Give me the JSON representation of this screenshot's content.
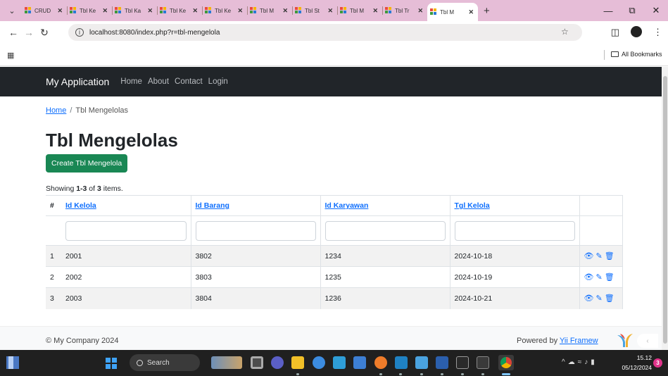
{
  "browser": {
    "tabs": [
      {
        "label": "CRUD",
        "active": false
      },
      {
        "label": "Tbl Ke",
        "active": false
      },
      {
        "label": "Tbl Ka",
        "active": false
      },
      {
        "label": "Tbl Ke",
        "active": false
      },
      {
        "label": "Tbl Ke",
        "active": false
      },
      {
        "label": "Tbl M",
        "active": false
      },
      {
        "label": "Tbl St",
        "active": false
      },
      {
        "label": "Tbl M",
        "active": false
      },
      {
        "label": "Tbl Tr",
        "active": false
      },
      {
        "label": "Tbl M",
        "active": true
      }
    ],
    "url": "localhost:8080/index.php?r=tbl-mengelola",
    "bookmarks_label": "All Bookmarks"
  },
  "app": {
    "brand": "My Application",
    "nav": [
      "Home",
      "About",
      "Contact",
      "Login"
    ],
    "breadcrumb": {
      "home": "Home",
      "separator": "/",
      "current": "Tbl Mengelolas"
    },
    "title": "Tbl Mengelolas",
    "create_button": "Create Tbl Mengelola",
    "summary": {
      "prefix": "Showing ",
      "range": "1-3",
      "mid": " of ",
      "total": "3",
      "suffix": " items."
    },
    "table": {
      "columns": [
        "#",
        "Id Kelola",
        "Id Barang",
        "Id Karyawan",
        "Tgl Kelola"
      ],
      "rows": [
        {
          "num": "1",
          "id_kelola": "2001",
          "id_barang": "3802",
          "id_karyawan": "1234",
          "tgl_kelola": "2024-10-18"
        },
        {
          "num": "2",
          "id_kelola": "2002",
          "id_barang": "3803",
          "id_karyawan": "1235",
          "tgl_kelola": "2024-10-19"
        },
        {
          "num": "3",
          "id_kelola": "2003",
          "id_barang": "3804",
          "id_karyawan": "1236",
          "tgl_kelola": "2024-10-21"
        }
      ]
    },
    "footer": {
      "copyright": "© My Company 2024",
      "powered_prefix": "Powered by ",
      "powered_link": "Yii Framew"
    }
  },
  "taskbar": {
    "search_label": "Search",
    "time": "15.12",
    "date": "05/12/2024",
    "notification_count": "3"
  },
  "colors": {
    "tab_strip": "#e6bdd7",
    "navbar": "#212529",
    "create_button": "#198754",
    "link": "#0d6efd",
    "taskbar": "#202020"
  }
}
